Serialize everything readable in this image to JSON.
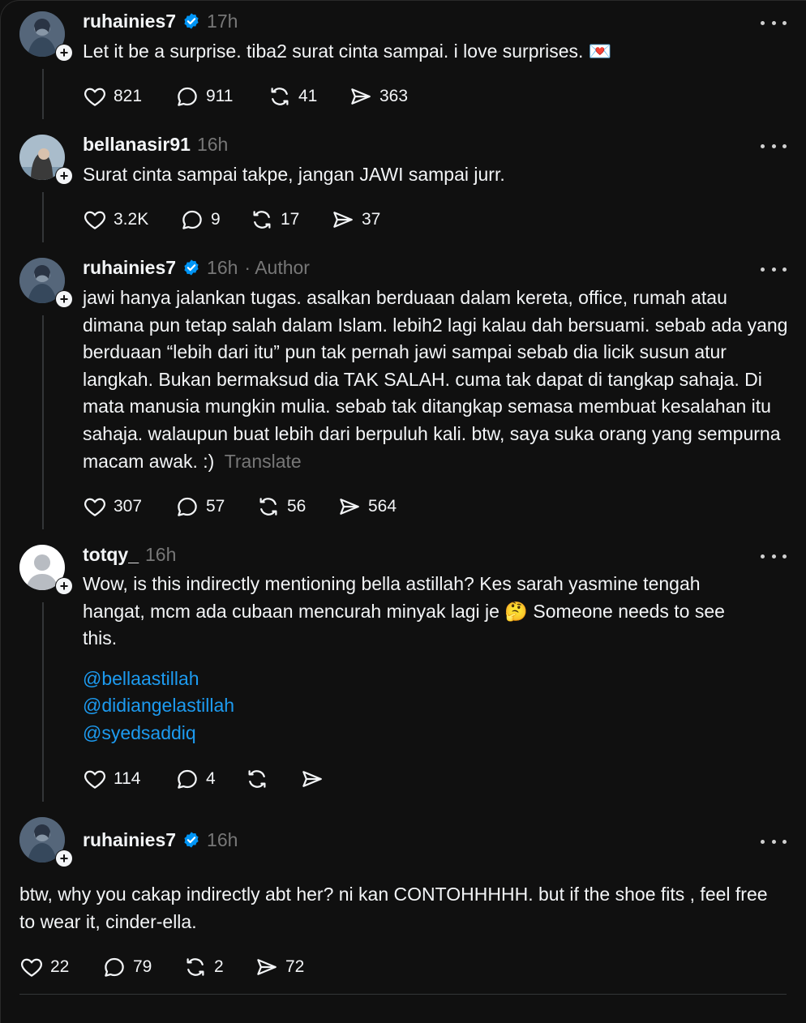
{
  "posts": [
    {
      "username": "ruhainies7",
      "verified": true,
      "time": "17h",
      "text": "Let it be a surprise. tiba2 surat cinta sampai. i love surprises. 💌",
      "likes": "821",
      "replies": "911",
      "reposts": "41",
      "shares": "363"
    },
    {
      "username": "bellanasir91",
      "verified": false,
      "time": "16h",
      "text": "Surat cinta sampai takpe, jangan JAWI sampai jurr.",
      "likes": "3.2K",
      "replies": "9",
      "reposts": "17",
      "shares": "37"
    },
    {
      "username": "ruhainies7",
      "verified": true,
      "time": "16h",
      "author_tag": "· Author",
      "text": "jawi hanya jalankan tugas. asalkan berduaan dalam kereta, office, rumah atau dimana pun tetap salah dalam Islam. lebih2 lagi kalau dah bersuami. sebab ada yang berduaan “lebih dari itu” pun tak pernah jawi sampai sebab dia licik susun atur langkah. Bukan bermaksud dia TAK SALAH. cuma tak dapat di tangkap sahaja. Di mata manusia mungkin mulia. sebab tak ditangkap semasa membuat kesalahan itu sahaja. walaupun buat lebih dari berpuluh kali. btw, saya suka orang yang sempurna macam awak. :)",
      "translate": "Translate",
      "likes": "307",
      "replies": "57",
      "reposts": "56",
      "shares": "564"
    },
    {
      "username": "totqy_",
      "verified": false,
      "time": "16h",
      "text": "Wow, is this indirectly mentioning bella astillah? Kes sarah yasmine tengah hangat, mcm ada cubaan mencurah minyak lagi je 🤔 Someone needs to see this.",
      "mentions": [
        "@bellaastillah",
        "@didiangelastillah",
        "@syedsaddiq"
      ],
      "likes": "114",
      "replies": "4",
      "reposts": "",
      "shares": ""
    },
    {
      "username": "ruhainies7",
      "verified": true,
      "time": "16h",
      "text": "btw, why you cakap indirectly abt her? ni kan CONTOHHHHH. but if the shoe fits , feel free to wear it, cinder-ella.",
      "likes": "22",
      "replies": "79",
      "reposts": "2",
      "shares": "72"
    }
  ],
  "icons": {
    "like": "heart-icon",
    "reply": "reply-bubble-icon",
    "repost": "repost-icon",
    "share": "share-send-icon",
    "more": "more-dots-icon",
    "verified": "verified-badge-icon",
    "follow": "follow-plus-icon"
  },
  "colors": {
    "background": "#101010",
    "text": "#f3f5f7",
    "muted": "#777777",
    "verified": "#0095f6",
    "mention": "#1d9bf0"
  }
}
